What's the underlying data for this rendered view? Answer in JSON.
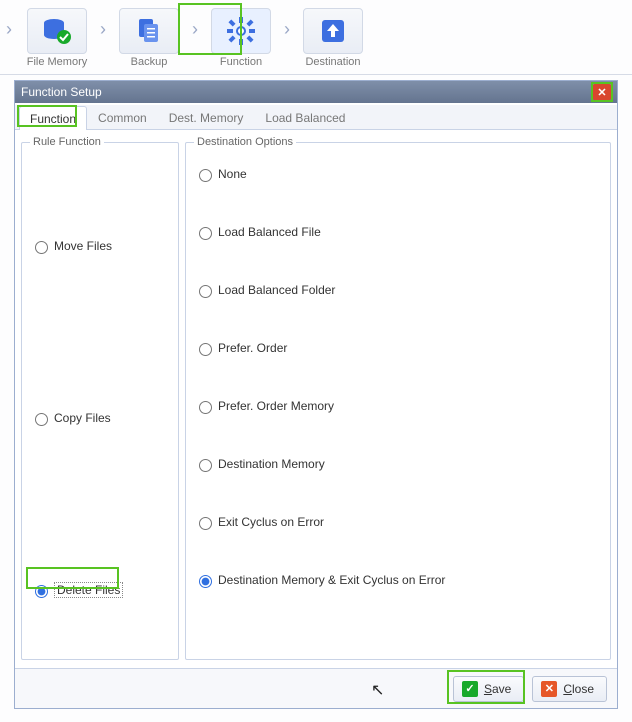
{
  "wizard": {
    "steps": [
      {
        "label": "File Memory"
      },
      {
        "label": "Backup"
      },
      {
        "label": "Function"
      },
      {
        "label": "Destination"
      }
    ]
  },
  "dialog": {
    "title": "Function Setup",
    "tabs": {
      "function": "Function",
      "common": "Common",
      "dest_memory": "Dest. Memory",
      "load_balanced": "Load Balanced"
    },
    "rule_legend": "Rule Function",
    "dest_legend": "Destination Options",
    "rule": {
      "move": "Move Files",
      "copy": "Copy Files",
      "delete": "Delete Files"
    },
    "dest": {
      "none": "None",
      "lbf": "Load Balanced File",
      "lbd": "Load Balanced Folder",
      "pref": "Prefer. Order",
      "prefm": "Prefer. Order Memory",
      "dmem": "Destination Memory",
      "exit": "Exit Cyclus on Error",
      "dmemexit": "Destination Memory & Exit Cyclus on Error"
    },
    "buttons": {
      "save_u": "S",
      "save_rest": "ave",
      "close_u": "C",
      "close_rest": "lose"
    }
  }
}
